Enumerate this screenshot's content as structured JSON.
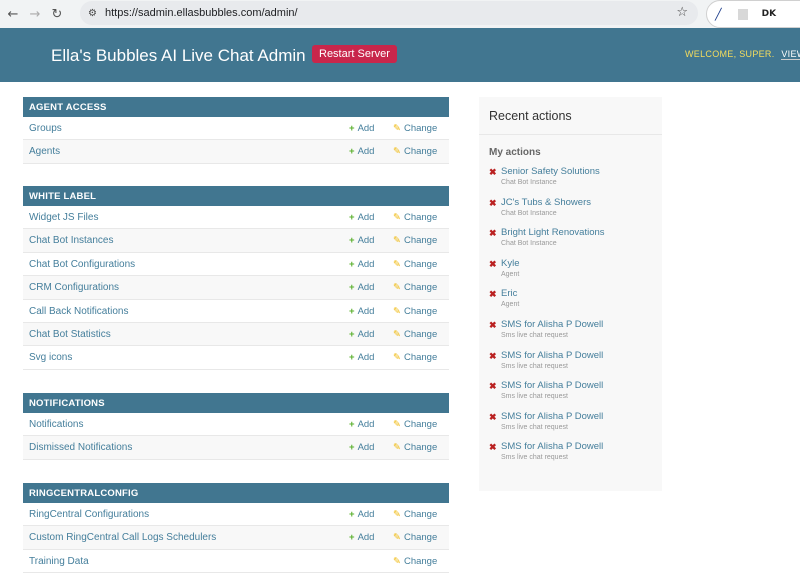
{
  "browser": {
    "url": "https://sadmin.ellasbubbles.com/admin/",
    "ext_badge": "DK"
  },
  "header": {
    "site_title": "Ella's Bubbles AI Live Chat Admin",
    "restart_label": "Restart Server",
    "welcome": "WELCOME,",
    "user": "SUPER.",
    "view_site": "VIEW SIT"
  },
  "labels": {
    "add": "Add",
    "change": "Change"
  },
  "modules": [
    {
      "title": "AGENT ACCESS",
      "rows": [
        {
          "name": "Groups",
          "add": true
        },
        {
          "name": "Agents",
          "add": true
        }
      ]
    },
    {
      "title": "WHITE LABEL",
      "rows": [
        {
          "name": "Widget JS Files",
          "add": true
        },
        {
          "name": "Chat Bot Instances",
          "add": true
        },
        {
          "name": "Chat Bot Configurations",
          "add": true
        },
        {
          "name": "CRM Configurations",
          "add": true
        },
        {
          "name": "Call Back Notifications",
          "add": true
        },
        {
          "name": "Chat Bot Statistics",
          "add": true
        },
        {
          "name": "Svg icons",
          "add": true
        }
      ]
    },
    {
      "title": "NOTIFICATIONS",
      "rows": [
        {
          "name": "Notifications",
          "add": true
        },
        {
          "name": "Dismissed Notifications",
          "add": true
        }
      ]
    },
    {
      "title": "RINGCENTRALCONFIG",
      "rows": [
        {
          "name": "RingCentral Configurations",
          "add": true
        },
        {
          "name": "Custom RingCentral Call Logs Schedulers",
          "add": true
        },
        {
          "name": "Training Data",
          "add": false
        }
      ]
    }
  ],
  "recent": {
    "title": "Recent actions",
    "subtitle": "My actions",
    "items": [
      {
        "title": "Senior Safety Solutions",
        "type": "Chat Bot Instance"
      },
      {
        "title": "JC's Tubs & Showers",
        "type": "Chat Bot Instance"
      },
      {
        "title": "Bright Light Renovations",
        "type": "Chat Bot Instance"
      },
      {
        "title": "Kyle",
        "type": "Agent"
      },
      {
        "title": "Eric",
        "type": "Agent"
      },
      {
        "title": "SMS for Alisha P Dowell",
        "type": "Sms live chat request"
      },
      {
        "title": "SMS for Alisha P Dowell",
        "type": "Sms live chat request"
      },
      {
        "title": "SMS for Alisha P Dowell",
        "type": "Sms live chat request"
      },
      {
        "title": "SMS for Alisha P Dowell",
        "type": "Sms live chat request"
      },
      {
        "title": "SMS for Alisha P Dowell",
        "type": "Sms live chat request"
      }
    ]
  }
}
